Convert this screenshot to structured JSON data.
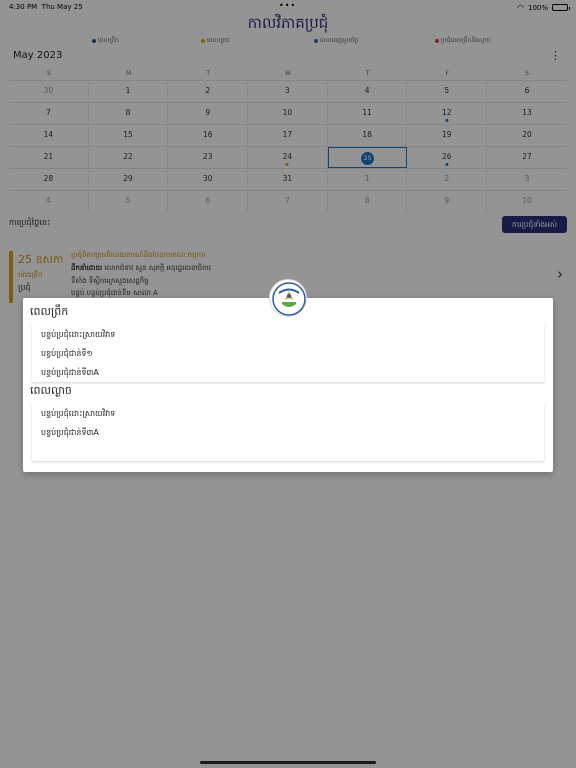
{
  "status_bar": {
    "time": "4:30 PM",
    "date": "Thu May 25",
    "dots": "•••",
    "battery": "100%"
  },
  "app": {
    "title": "កាលវិភាគប្រជុំ"
  },
  "legend": [
    {
      "label": "ពេលព្រឹក",
      "color": "#2c4fa8"
    },
    {
      "label": "ពេលល្ងាច",
      "color": "#d8a41e"
    },
    {
      "label": "ពេលពេញមួយថ្ងៃ",
      "color": "#1e78c8"
    },
    {
      "label": "ប្រជុំពេលព្រឹកនិងល្ងាច",
      "color": "#d84a1e"
    }
  ],
  "calendar": {
    "month": "May 2023",
    "weekdays": [
      "S",
      "M",
      "T",
      "W",
      "T",
      "F",
      "S"
    ],
    "weeks": [
      [
        {
          "d": "30",
          "m": true
        },
        {
          "d": "1"
        },
        {
          "d": "2"
        },
        {
          "d": "3"
        },
        {
          "d": "4"
        },
        {
          "d": "5"
        },
        {
          "d": "6"
        }
      ],
      [
        {
          "d": "7"
        },
        {
          "d": "8"
        },
        {
          "d": "9"
        },
        {
          "d": "10"
        },
        {
          "d": "11"
        },
        {
          "d": "12",
          "dot": "#1e78c8"
        },
        {
          "d": "13"
        }
      ],
      [
        {
          "d": "14"
        },
        {
          "d": "15"
        },
        {
          "d": "16"
        },
        {
          "d": "17"
        },
        {
          "d": "18"
        },
        {
          "d": "19"
        },
        {
          "d": "20"
        }
      ],
      [
        {
          "d": "21"
        },
        {
          "d": "22"
        },
        {
          "d": "23"
        },
        {
          "d": "24",
          "dot": "#d8a41e"
        },
        {
          "d": "25",
          "sel": true
        },
        {
          "d": "26",
          "dot": "#1e78c8"
        },
        {
          "d": "27"
        }
      ],
      [
        {
          "d": "28"
        },
        {
          "d": "29"
        },
        {
          "d": "30"
        },
        {
          "d": "31"
        },
        {
          "d": "1",
          "m": true
        },
        {
          "d": "2",
          "m": true
        },
        {
          "d": "3",
          "m": true
        }
      ],
      [
        {
          "d": "4",
          "m": true
        },
        {
          "d": "5",
          "m": true
        },
        {
          "d": "6",
          "m": true
        },
        {
          "d": "7",
          "m": true
        },
        {
          "d": "8",
          "m": true
        },
        {
          "d": "9",
          "m": true
        },
        {
          "d": "10",
          "m": true
        }
      ]
    ]
  },
  "meetings": {
    "label": "ការប្រជុំថ្ងៃនេះ",
    "all_button": "ការប្រជុំទាំងអស់",
    "card": {
      "date": "25 ឧសភា",
      "time": "ម៉ោងព្រឹក",
      "type": "ប្រជុំ",
      "title": "ប្រជុំពិភាក្សាលើរបាយការណ៍និងផែនការគណៈកម្មការ",
      "chair_label": "ដឹកនាំដោយ",
      "chair": "លោកជំទាវ សួន សុភក្តិ អនុរដ្ឋលេខាធិការ",
      "location": "ទីតាំង ទីស្តីការក្រសួងសេដ្ឋកិច្ច",
      "room": "បន្ទប់ បន្ទប់ប្រជុំជាន់ទីម សាលា A"
    }
  },
  "modal": {
    "morning_header": "ពេលព្រឹក",
    "morning_rooms": [
      "បន្ទប់ប្រជុំដោះស្រាយវិវាទ",
      "បន្ទប់ប្រជុំជាន់ទី១",
      "បន្ទប់ប្រជុំជាន់ទី៣A"
    ],
    "evening_header": "ពេលល្ងាច",
    "evening_rooms": [
      "បន្ទប់ប្រជុំដោះស្រាយវិវាទ",
      "បន្ទប់ប្រជុំជាន់ទី៣A"
    ]
  }
}
